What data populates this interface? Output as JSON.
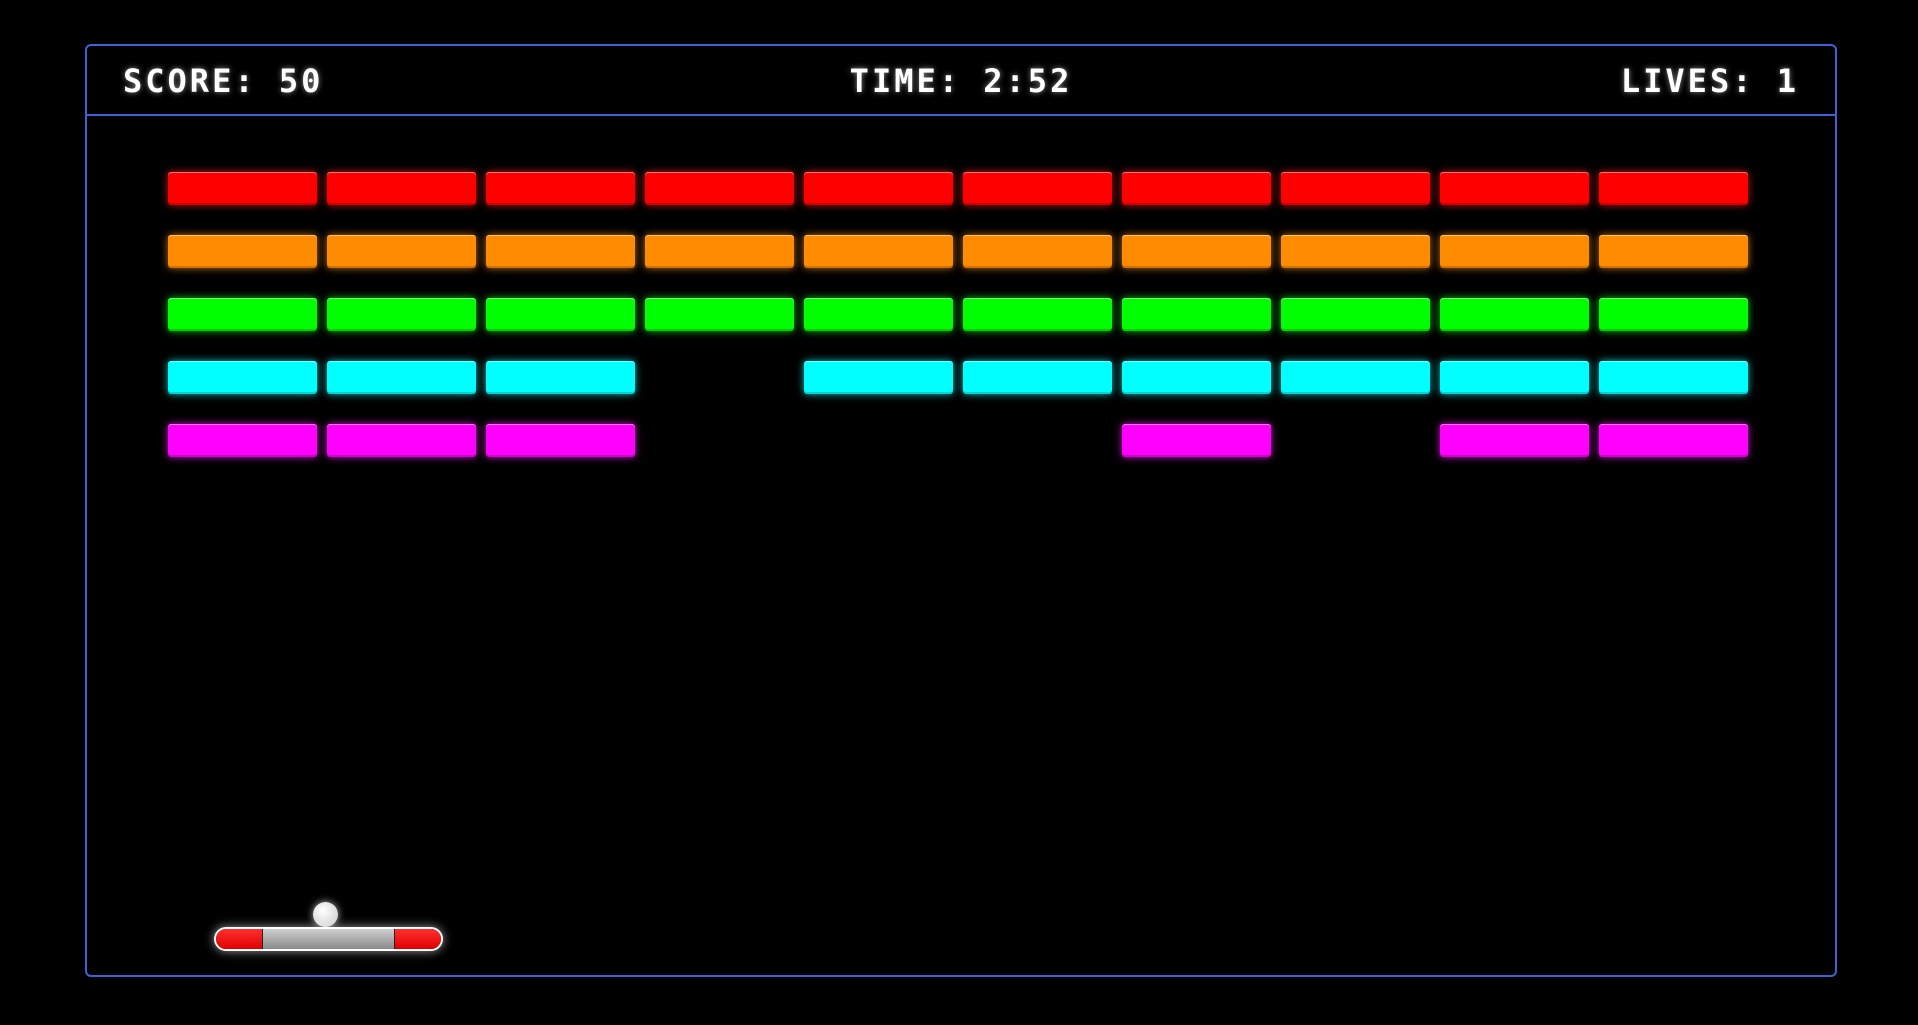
{
  "hud": {
    "score_text": "SCORE: 50",
    "time_text": "TIME: 2:52",
    "lives_text": "LIVES: 1"
  },
  "colors": {
    "frame_border": "#3b63d6",
    "background": "#000000",
    "hud_text": "#ffffff"
  },
  "bricks": {
    "rows": [
      {
        "color": "#ff0000",
        "glow": "rgba(255,40,40,0.75)",
        "present": [
          true,
          true,
          true,
          true,
          true,
          true,
          true,
          true,
          true,
          true
        ]
      },
      {
        "color": "#ff8c00",
        "glow": "rgba(255,150,30,0.75)",
        "present": [
          true,
          true,
          true,
          true,
          true,
          true,
          true,
          true,
          true,
          true
        ]
      },
      {
        "color": "#00ff00",
        "glow": "rgba(40,255,40,0.75)",
        "present": [
          true,
          true,
          true,
          true,
          true,
          true,
          true,
          true,
          true,
          true
        ]
      },
      {
        "color": "#00ffff",
        "glow": "rgba(40,255,255,0.75)",
        "present": [
          true,
          true,
          true,
          false,
          true,
          true,
          true,
          true,
          true,
          true
        ]
      },
      {
        "color": "#ff00ff",
        "glow": "rgba(255,40,255,0.75)",
        "present": [
          true,
          true,
          true,
          false,
          false,
          false,
          true,
          false,
          true,
          true
        ]
      }
    ]
  },
  "paddle": {
    "cap_color": "#ff0000",
    "body_color": "#b0b0b0"
  },
  "ball": {
    "color": "#ffffff"
  }
}
